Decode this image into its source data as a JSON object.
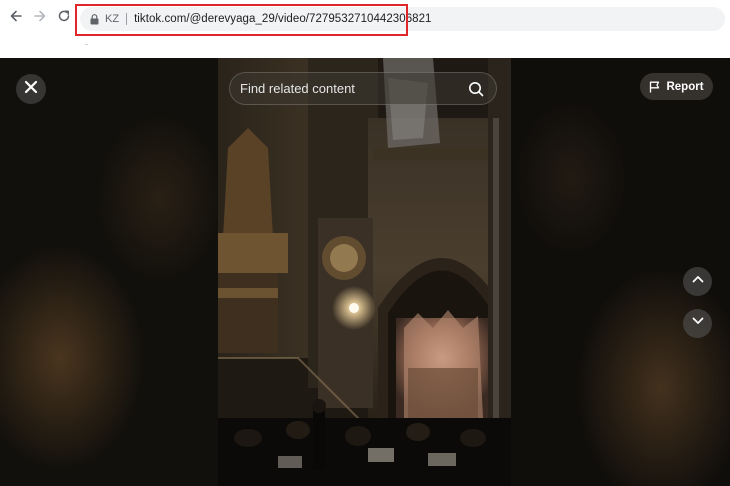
{
  "browser": {
    "back_icon": "arrow-left-icon",
    "forward_icon": "arrow-right-icon",
    "reload_icon": "reload-icon",
    "lock_icon": "lock-icon",
    "region": "KZ",
    "url": "tiktok.com/@derevyaga_29/video/7279532710442306821",
    "highlight_color": "#e0262a"
  },
  "viewer": {
    "close_icon": "close-icon",
    "search": {
      "placeholder": "Find related content",
      "icon": "search-icon"
    },
    "report": {
      "label": "Report",
      "icon": "flag-icon"
    },
    "prev_icon": "chevron-up-icon",
    "next_icon": "chevron-down-icon"
  }
}
